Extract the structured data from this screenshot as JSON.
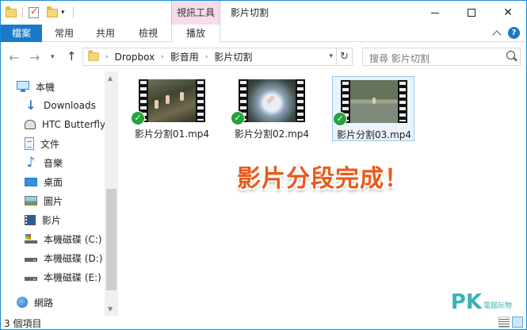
{
  "titlebar": {
    "contextual_tab": "視訊工具",
    "title": "影片切割"
  },
  "ribbon": {
    "tabs": [
      "檔案",
      "常用",
      "共用",
      "檢視",
      "播放"
    ]
  },
  "address": {
    "breadcrumbs": [
      "Dropbox",
      "影音用",
      "影片切割"
    ],
    "search_placeholder": "搜尋 影片切割"
  },
  "sidebar": {
    "items": [
      {
        "label": "本機",
        "icon": "pc-icon"
      },
      {
        "label": "Downloads",
        "icon": "download-icon"
      },
      {
        "label": "HTC Butterfly",
        "icon": "phone-icon"
      },
      {
        "label": "文件",
        "icon": "document-icon"
      },
      {
        "label": "音樂",
        "icon": "music-icon"
      },
      {
        "label": "桌面",
        "icon": "desktop-icon"
      },
      {
        "label": "圖片",
        "icon": "pictures-icon"
      },
      {
        "label": "影片",
        "icon": "videos-icon"
      },
      {
        "label": "本機磁碟 (C:)",
        "icon": "windows-drive-icon"
      },
      {
        "label": "本機磁碟 (D:)",
        "icon": "drive-icon"
      },
      {
        "label": "本機磁碟 (E:)",
        "icon": "drive-icon"
      },
      {
        "label": "網路",
        "icon": "network-icon"
      }
    ]
  },
  "files": [
    {
      "name": "影片分割01.mp4",
      "selected": false
    },
    {
      "name": "影片分割02.mp4",
      "selected": false
    },
    {
      "name": "影片分割03.mp4",
      "selected": true
    }
  ],
  "banner": "影片分段完成！",
  "watermark": {
    "logo": "PK",
    "text": "電腦玩物"
  },
  "status": {
    "count": "3 個項目"
  },
  "colors": {
    "accent": "#1979ca",
    "banner": "#e85a1c",
    "contextual_tab": "#f6dcea",
    "success": "#25a33a"
  }
}
